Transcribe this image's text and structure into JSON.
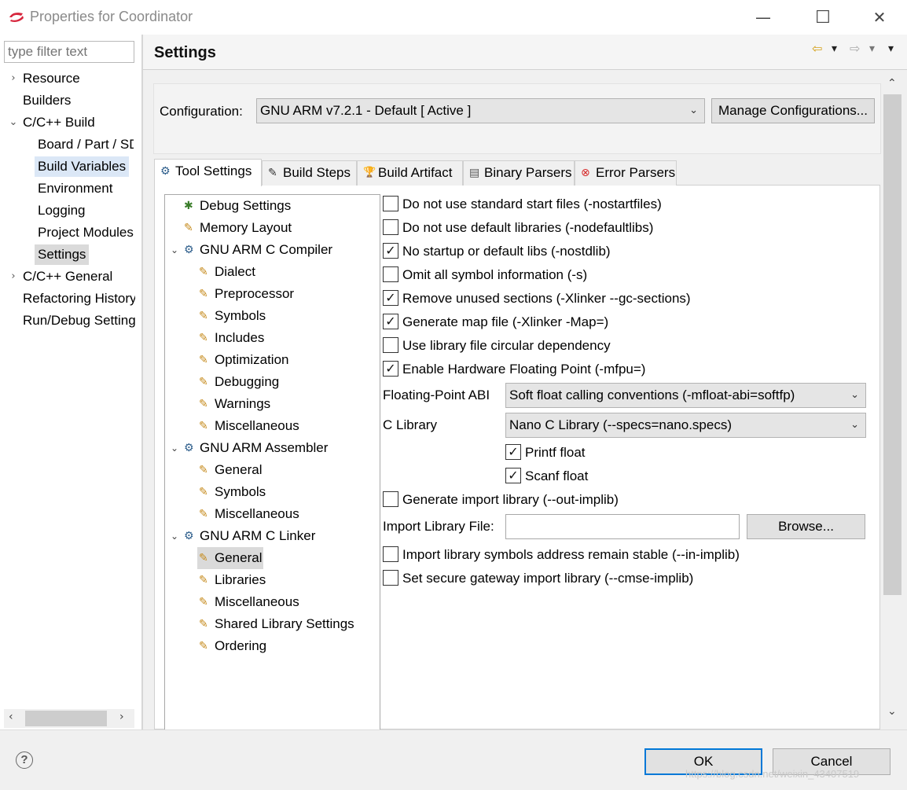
{
  "window": {
    "title": "Properties for Coordinator",
    "minimize_glyph": "—",
    "maximize_glyph": "☐",
    "close_glyph": "✕"
  },
  "nav": {
    "filter_placeholder": "type filter text",
    "items": [
      {
        "label": "Resource",
        "expander": "›"
      },
      {
        "label": "Builders"
      },
      {
        "label": "C/C++ Build",
        "expander": "⌄"
      },
      {
        "label": "Board / Part / SDK"
      },
      {
        "label": "Build Variables"
      },
      {
        "label": "Environment"
      },
      {
        "label": "Logging"
      },
      {
        "label": "Project Modules"
      },
      {
        "label": "Settings"
      },
      {
        "label": "C/C++ General",
        "expander": "›"
      },
      {
        "label": "Refactoring History"
      },
      {
        "label": "Run/Debug Settings"
      }
    ],
    "scroll_left": "‹",
    "scroll_right": "›"
  },
  "page": {
    "title": "Settings",
    "back_icon": "⇦",
    "forward_icon": "⇨",
    "menu_arrow": "▾"
  },
  "config": {
    "label": "Configuration:",
    "value": "GNU ARM v7.2.1 - Default  [ Active ]",
    "manage_label": "Manage Configurations..."
  },
  "tabs": [
    {
      "label": "Tool Settings",
      "icon": "⚙"
    },
    {
      "label": "Build Steps",
      "icon": "✎"
    },
    {
      "label": "Build Artifact",
      "icon": "🏆"
    },
    {
      "label": "Binary Parsers",
      "icon": "▤"
    },
    {
      "label": "Error Parsers",
      "icon": "⊗"
    }
  ],
  "tree": [
    {
      "label": "Debug Settings",
      "level": 1,
      "icon": "✱"
    },
    {
      "label": "Memory Layout",
      "level": 1,
      "icon": "✎"
    },
    {
      "label": "GNU ARM C Compiler",
      "level": 0,
      "icon": "⚙",
      "expander": "⌄"
    },
    {
      "label": "Dialect",
      "level": 2,
      "icon": "✎"
    },
    {
      "label": "Preprocessor",
      "level": 2,
      "icon": "✎"
    },
    {
      "label": "Symbols",
      "level": 2,
      "icon": "✎"
    },
    {
      "label": "Includes",
      "level": 2,
      "icon": "✎"
    },
    {
      "label": "Optimization",
      "level": 2,
      "icon": "✎"
    },
    {
      "label": "Debugging",
      "level": 2,
      "icon": "✎"
    },
    {
      "label": "Warnings",
      "level": 2,
      "icon": "✎"
    },
    {
      "label": "Miscellaneous",
      "level": 2,
      "icon": "✎"
    },
    {
      "label": "GNU ARM Assembler",
      "level": 0,
      "icon": "⚙",
      "expander": "⌄"
    },
    {
      "label": "General",
      "level": 2,
      "icon": "✎"
    },
    {
      "label": "Symbols",
      "level": 2,
      "icon": "✎"
    },
    {
      "label": "Miscellaneous",
      "level": 2,
      "icon": "✎"
    },
    {
      "label": "GNU ARM C Linker",
      "level": 0,
      "icon": "⚙",
      "expander": "⌄"
    },
    {
      "label": "General",
      "level": 2,
      "icon": "✎"
    },
    {
      "label": "Libraries",
      "level": 2,
      "icon": "✎"
    },
    {
      "label": "Miscellaneous",
      "level": 2,
      "icon": "✎"
    },
    {
      "label": "Shared Library Settings",
      "level": 2,
      "icon": "✎"
    },
    {
      "label": "Ordering",
      "level": 2,
      "icon": "✎"
    }
  ],
  "options": {
    "nostartfiles": {
      "label": "Do not use standard start files (-nostartfiles)",
      "checked": false
    },
    "nodefaultlibs": {
      "label": "Do not use default libraries (-nodefaultlibs)",
      "checked": false
    },
    "nostdlib": {
      "label": "No startup or default libs (-nostdlib)",
      "checked": true
    },
    "omit_symbols": {
      "label": "Omit all symbol information (-s)",
      "checked": false
    },
    "gc_sections": {
      "label": "Remove unused sections (-Xlinker --gc-sections)",
      "checked": true
    },
    "map_file": {
      "label": "Generate map file (-Xlinker -Map=)",
      "checked": true
    },
    "circular": {
      "label": "Use library file circular dependency",
      "checked": false
    },
    "hw_float": {
      "label": "Enable Hardware Floating Point (-mfpu=)",
      "checked": true
    },
    "float_abi_label": "Floating-Point ABI",
    "float_abi_value": "Soft float calling conventions (-mfloat-abi=softfp)",
    "c_library_label": "C Library",
    "c_library_value": "Nano C Library (--specs=nano.specs)",
    "printf_float": {
      "label": "Printf float",
      "checked": true
    },
    "scanf_float": {
      "label": "Scanf float",
      "checked": true
    },
    "out_implib": {
      "label": "Generate import library (--out-implib)",
      "checked": false
    },
    "import_file_label": "Import Library File:",
    "import_file_value": "",
    "browse_label": "Browse...",
    "in_implib": {
      "label": "Import library symbols address remain stable (--in-implib)",
      "checked": false
    },
    "cmse_implib": {
      "label": "Set secure gateway import library (--cmse-implib)",
      "checked": false
    },
    "check_glyph": "✓",
    "combo_chevron": "⌄"
  },
  "scroll": {
    "up": "⌃",
    "down": "⌄"
  },
  "footer": {
    "help_glyph": "?",
    "ok_label": "OK",
    "cancel_label": "Cancel",
    "watermark": "https://blog.csdn.net/weixin_43407519"
  }
}
